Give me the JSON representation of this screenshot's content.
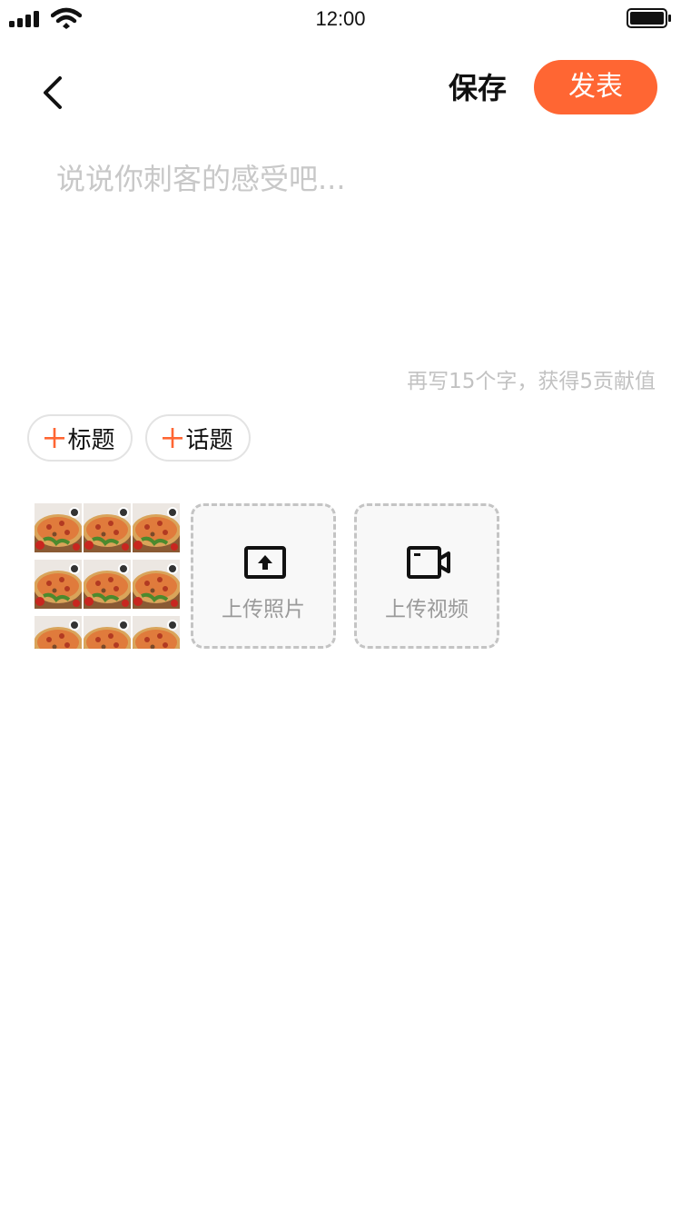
{
  "status_bar": {
    "time": "12:00",
    "icons": [
      "signal-icon",
      "wifi-icon",
      "battery-icon"
    ]
  },
  "nav": {
    "back_icon": "chevron-left-icon",
    "save_label": "保存",
    "publish_label": "发表"
  },
  "editor": {
    "placeholder": "说说你刺客的感受吧...",
    "value": "",
    "hint": "再写15个字，获得5贡献值"
  },
  "tags": [
    {
      "label": "标题",
      "icon": "plus-icon"
    },
    {
      "label": "话题",
      "icon": "plus-icon"
    }
  ],
  "media": {
    "photo_count": 9,
    "upload_photo_label": "上传照片",
    "upload_photo_icon": "upload-photo-icon",
    "upload_video_label": "上传视频",
    "upload_video_icon": "video-camera-icon"
  },
  "colors": {
    "accent": "#ff6633",
    "placeholder": "#c8c8c8",
    "hint": "#c2c2c2",
    "pill_border": "#e3e3e3",
    "tile_border": "#c4c4c4",
    "tile_bg": "#f8f8f8"
  }
}
